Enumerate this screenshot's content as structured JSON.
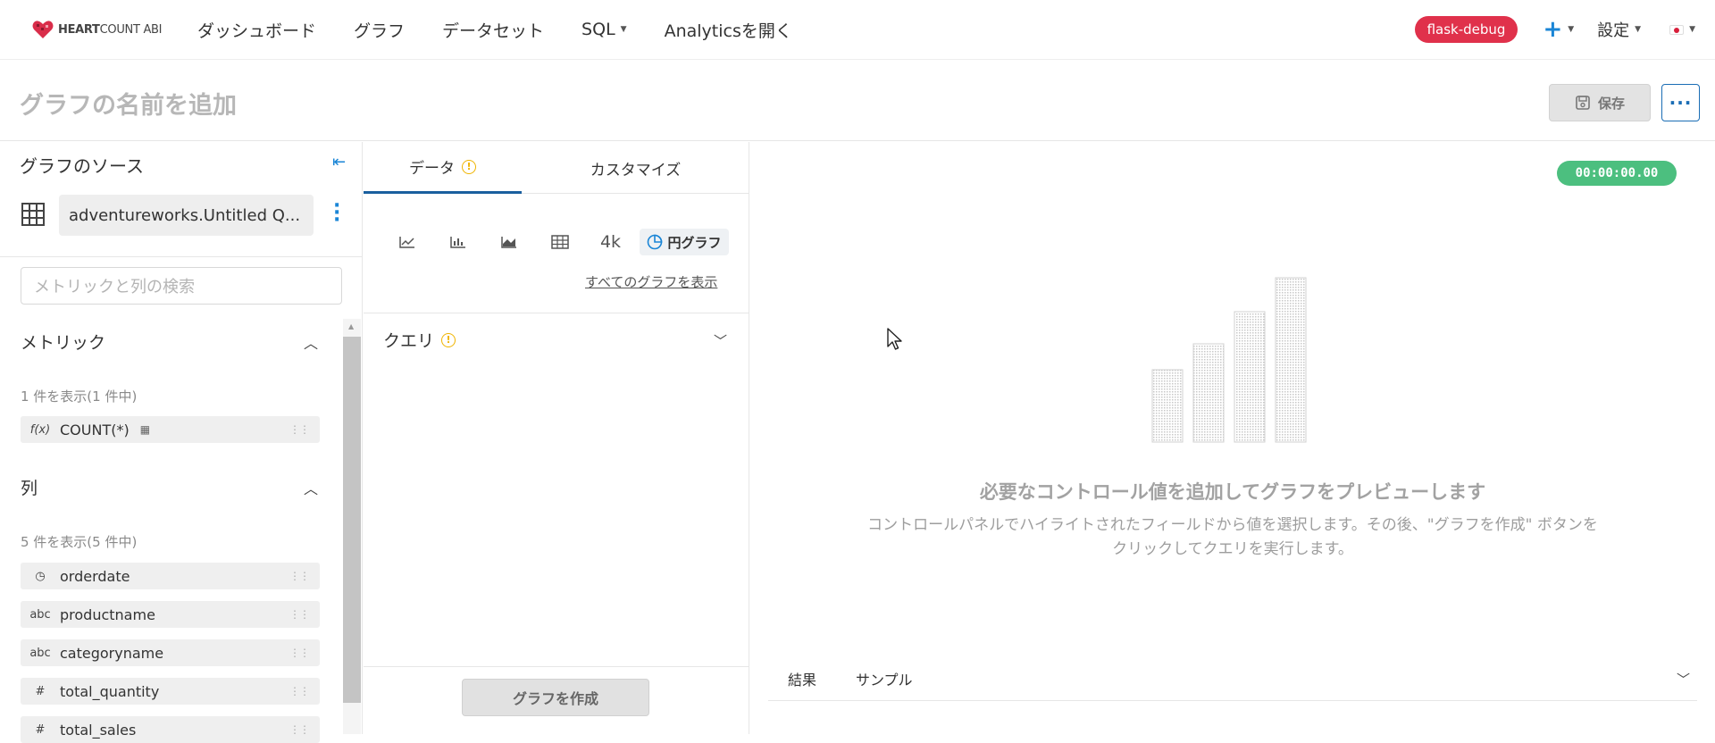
{
  "nav": {
    "logo_brand": "HEART",
    "logo_rest": "COUNT ABI",
    "items": [
      "ダッシュボード",
      "グラフ",
      "データセット",
      "SQL",
      "Analyticsを開く"
    ],
    "env_badge": "flask-debug",
    "plus": "+",
    "settings": "設定"
  },
  "titlebar": {
    "title": "グラフの名前を追加",
    "save": "保存",
    "more": "···"
  },
  "source": {
    "heading": "グラフのソース",
    "dataset": "adventureworks.Untitled Q...",
    "search_placeholder": "メトリックと列の検索"
  },
  "metrics": {
    "heading": "メトリック",
    "count": "1 件を表示(1 件中)",
    "items": [
      {
        "type": "f(x)",
        "label": "COUNT(*)"
      }
    ]
  },
  "columns": {
    "heading": "列",
    "count": "5 件を表示(5 件中)",
    "items": [
      {
        "type": "clock",
        "label": "orderdate"
      },
      {
        "type": "abc",
        "label": "productname"
      },
      {
        "type": "abc",
        "label": "categoryname"
      },
      {
        "type": "#",
        "label": "total_quantity"
      },
      {
        "type": "#",
        "label": "total_sales"
      }
    ]
  },
  "tabs": {
    "data": "データ",
    "customize": "カスタマイズ"
  },
  "chart_types": {
    "big_number": "4k",
    "pie": "円グラフ",
    "show_all": "すべてのグラフを表示"
  },
  "query": {
    "heading": "クエリ"
  },
  "create_button": "グラフを作成",
  "preview": {
    "timer": "00:00:00.00",
    "title": "必要なコントロール値を追加してグラフをプレビューします",
    "description": "コントロールパネルでハイライトされたフィールドから値を選択します。その後、\"グラフを作成\" ボタンをクリックしてクエリを実行します。"
  },
  "results": {
    "tab1": "結果",
    "tab2": "サンプル"
  },
  "colors": {
    "accent": "#1a85d6",
    "badge": "#e0314b",
    "timer": "#4cbf7f"
  }
}
